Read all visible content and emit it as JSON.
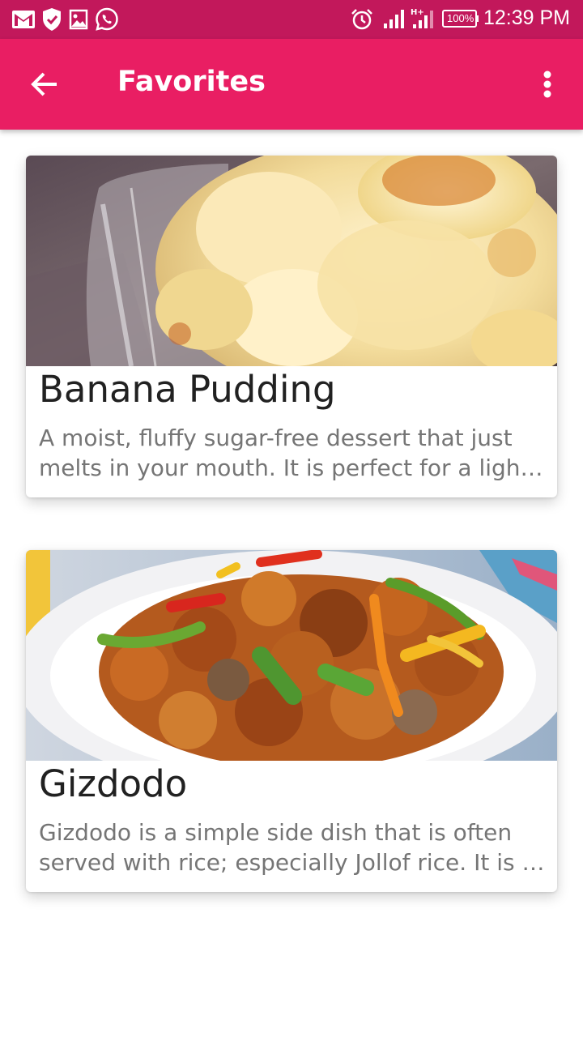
{
  "status_bar": {
    "left_icons": [
      "gmail-icon",
      "shield-icon",
      "gallery-icon",
      "whatsapp-icon"
    ],
    "right_icons": [
      "alarm-icon",
      "signal-icon",
      "data-signal-icon",
      "battery-icon"
    ],
    "battery": "100%",
    "time": "12:39 PM",
    "color": "#c2185b"
  },
  "app_bar": {
    "title": "Favorites",
    "back_icon": "arrow-left-icon",
    "menu_icon": "more-vertical-icon",
    "color": "#e91e63"
  },
  "cards": [
    {
      "title": "Banana Pudding",
      "description": "A moist, fluffy sugar-free dessert that just melts in your mouth.  It is perfect for a light dessert after a heavy meal."
    },
    {
      "title": "Gizdodo",
      "description": "Gizdodo is a simple side dish that is often served with rice; especially Jollof rice. It is a combination of gizzards and plantain."
    }
  ]
}
